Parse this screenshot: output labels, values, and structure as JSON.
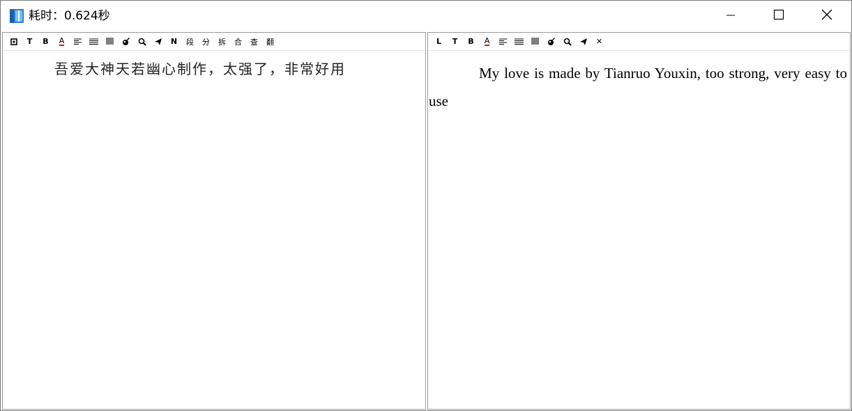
{
  "window": {
    "title": "耗时：0.624秒",
    "app_icon": "book-icon",
    "controls": {
      "minimize": "minimize-icon",
      "maximize": "maximize-icon",
      "close": "close-icon"
    }
  },
  "left_pane": {
    "toolbar": {
      "buttons": [
        {
          "name": "layout-toggle",
          "icon": "square-dot-icon"
        },
        {
          "name": "text-mode",
          "label": "T"
        },
        {
          "name": "bold",
          "label": "B"
        },
        {
          "name": "font-color",
          "label": "A",
          "underline_color": "#e01010"
        },
        {
          "name": "align-left",
          "icon": "align-left-icon"
        },
        {
          "name": "align-justify",
          "icon": "align-justify-icon"
        },
        {
          "name": "align-full",
          "icon": "align-full-icon"
        },
        {
          "name": "clear",
          "icon": "eraser-icon"
        },
        {
          "name": "search",
          "icon": "search-icon"
        },
        {
          "name": "send",
          "icon": "send-icon"
        },
        {
          "name": "n-mode",
          "label": "N"
        },
        {
          "name": "paragraph",
          "label": "段"
        },
        {
          "name": "split",
          "label": "分"
        },
        {
          "name": "break",
          "label": "拆"
        },
        {
          "name": "merge",
          "label": "合"
        },
        {
          "name": "lookup",
          "label": "查"
        },
        {
          "name": "translate",
          "label": "翻"
        }
      ]
    },
    "text": "吾爱大神天若幽心制作，太强了，非常好用"
  },
  "right_pane": {
    "toolbar": {
      "buttons": [
        {
          "name": "layout-l",
          "label": "L"
        },
        {
          "name": "text-mode",
          "label": "T"
        },
        {
          "name": "bold",
          "label": "B"
        },
        {
          "name": "font-color",
          "label": "A",
          "underline_color": "#e01010"
        },
        {
          "name": "align-left",
          "icon": "align-left-icon"
        },
        {
          "name": "align-justify",
          "icon": "align-justify-icon"
        },
        {
          "name": "align-full",
          "icon": "align-full-icon"
        },
        {
          "name": "clear",
          "icon": "eraser-icon"
        },
        {
          "name": "search",
          "icon": "search-icon"
        },
        {
          "name": "send",
          "icon": "send-icon"
        },
        {
          "name": "close",
          "label": "✕"
        }
      ]
    },
    "text": "My love is made by Tianruo Youxin, too strong, very easy to use"
  }
}
